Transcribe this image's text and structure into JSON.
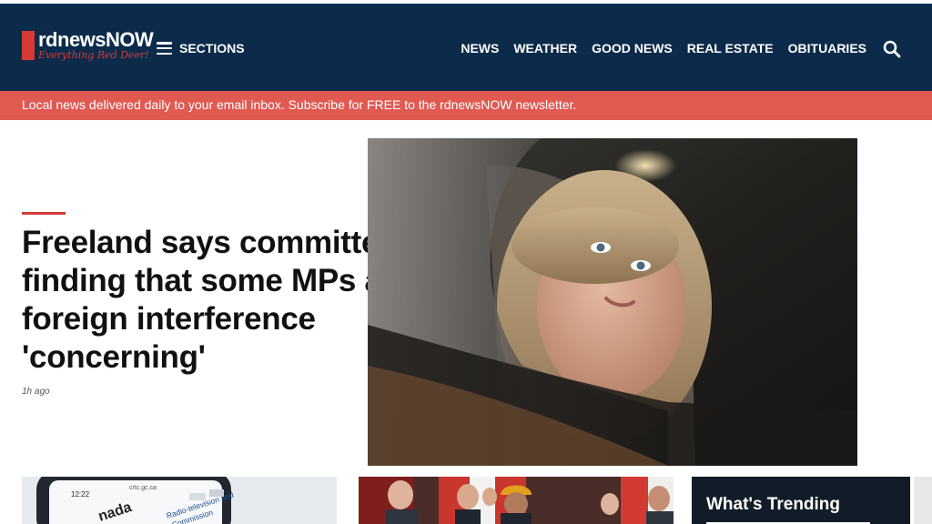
{
  "header": {
    "logo_name": "rdnewsNOW",
    "logo_tagline": "Everything Red Deer!",
    "sections_label": "SECTIONS",
    "nav": [
      "NEWS",
      "WEATHER",
      "GOOD NEWS",
      "REAL ESTATE",
      "OBITUARIES"
    ],
    "bg_color": "#0c2b4b",
    "accent_color": "#d63a35"
  },
  "banner": {
    "text": "Local news delivered daily to your email inbox. Subscribe for FREE to the rdnewsNOW newsletter.",
    "bg_color": "#e05a52"
  },
  "hero": {
    "headline": "Freeland says committee finding that some MPs aided foreign interference 'concerning'",
    "time_ago": "1h ago"
  },
  "cards": {
    "card1_text": [
      "12:22",
      "crtc.gc.ca",
      "nada",
      "Radio-television and",
      "Commission"
    ]
  },
  "trending": {
    "title": "What's Trending"
  }
}
